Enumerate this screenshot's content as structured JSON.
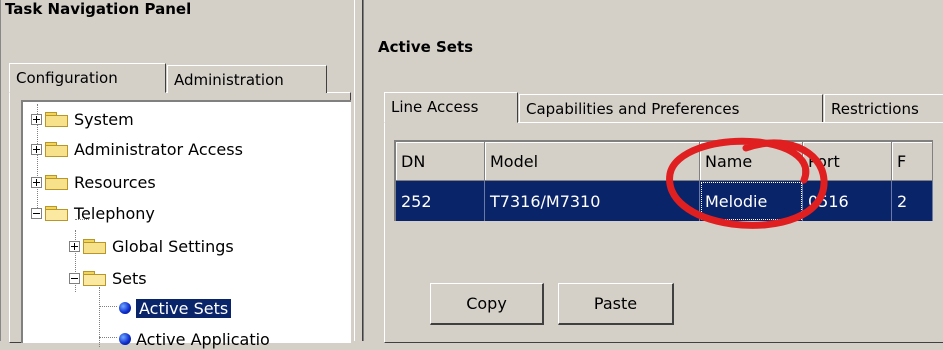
{
  "left_panel": {
    "title": "Task Navigation Panel",
    "tabs": [
      {
        "label": "Configuration",
        "active": true
      },
      {
        "label": "Administration",
        "active": false
      }
    ],
    "tree": [
      {
        "label": "System",
        "icon": "folder-icon",
        "expander": "plus"
      },
      {
        "label": "Administrator Access",
        "icon": "folder-icon",
        "expander": "plus"
      },
      {
        "label": "Resources",
        "icon": "folder-icon",
        "expander": "plus"
      },
      {
        "label": "Telephony",
        "icon": "folder-open-icon",
        "expander": "minus"
      },
      {
        "label": "Global Settings",
        "icon": "folder-icon",
        "expander": "plus"
      },
      {
        "label": "Sets",
        "icon": "folder-open-icon",
        "expander": "minus"
      },
      {
        "label": "Active Sets",
        "icon": "blue-dot-icon",
        "selected": true
      },
      {
        "label": "Active Applicatio",
        "icon": "blue-dot-icon"
      }
    ]
  },
  "main": {
    "section_title": "Active Sets",
    "tabs": [
      {
        "label": "Line Access",
        "active": true
      },
      {
        "label": "Capabilities and Preferences",
        "active": false
      },
      {
        "label": "Restrictions",
        "active": false
      }
    ],
    "table": {
      "columns": [
        "DN",
        "Model",
        "Name",
        "Port",
        "F"
      ],
      "rows": [
        {
          "cells": [
            "252",
            "T7316/M7310",
            "Melodie",
            "0516",
            "2"
          ],
          "selected": true,
          "focused_column": 2
        }
      ]
    },
    "buttons": {
      "copy": "Copy",
      "paste": "Paste"
    }
  },
  "annotation": {
    "color": "#e02020",
    "shape": "hand-drawn-circle-around-name"
  },
  "colors": {
    "selection": "#0a246a",
    "window_face": "#d4d0c8"
  }
}
